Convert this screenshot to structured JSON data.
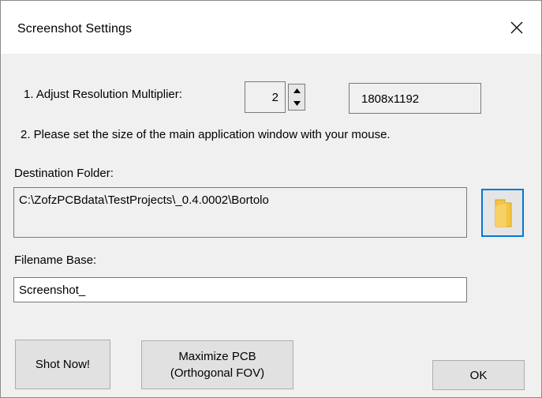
{
  "window": {
    "title": "Screenshot Settings",
    "close_glyph": "close-icon"
  },
  "resolution": {
    "label": "1. Adjust Resolution Multiplier:",
    "multiplier": "2",
    "result": "1808x1192"
  },
  "instruction": "2. Please set the size of the main application window with your mouse.",
  "destination": {
    "label": "Destination Folder:",
    "path": "C:\\ZofzPCBdata\\TestProjects\\_0.4.0002\\Bortolo",
    "browse_icon": "folder-icon"
  },
  "filename": {
    "label": "Filename Base:",
    "value": "Screenshot_"
  },
  "buttons": {
    "shot_now": "Shot Now!",
    "maximize_line1": "Maximize PCB",
    "maximize_line2": "(Orthogonal FOV)",
    "ok": "OK"
  },
  "colors": {
    "focus_border": "#0078d7",
    "folder": "#f4c542"
  }
}
